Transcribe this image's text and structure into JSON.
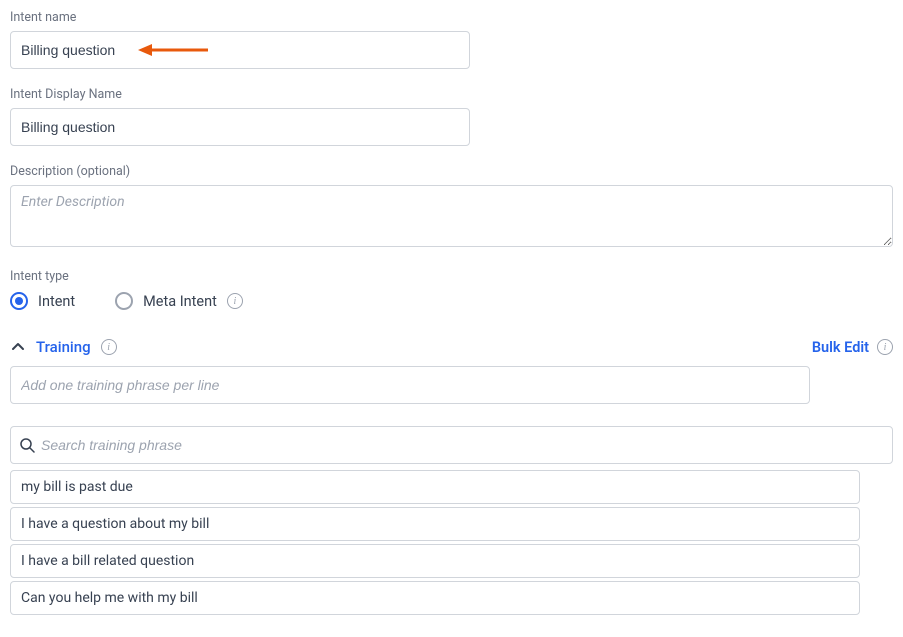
{
  "intent_name": {
    "label": "Intent name",
    "value": "Billing question"
  },
  "intent_display_name": {
    "label": "Intent Display Name",
    "value": "Billing question"
  },
  "description": {
    "label": "Description (optional)",
    "placeholder": "Enter Description",
    "value": ""
  },
  "intent_type": {
    "label": "Intent type",
    "options": {
      "intent": "Intent",
      "meta_intent": "Meta Intent"
    }
  },
  "training": {
    "title": "Training",
    "bulk_edit": "Bulk Edit",
    "add_placeholder": "Add one training phrase per line",
    "search_placeholder": "Search training phrase",
    "phrases": [
      "my bill is past due",
      "I have a question about my bill",
      "I have a bill related question",
      "Can you help me with my bill"
    ]
  },
  "annotation_arrow_color": "#e8590c"
}
